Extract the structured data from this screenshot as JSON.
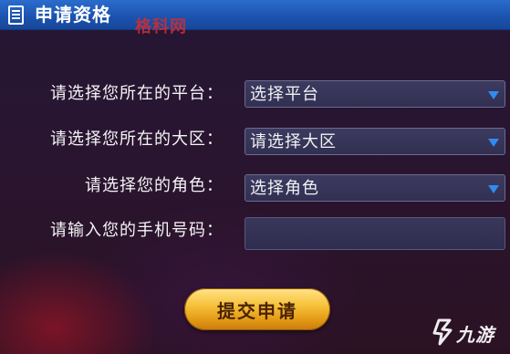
{
  "header": {
    "title": "申请资格",
    "icon": "document-icon"
  },
  "watermark": "格科网",
  "form": {
    "platform": {
      "label": "请选择您所在的平台：",
      "value": "选择平台"
    },
    "region": {
      "label": "请选择您所在的大区：",
      "value": "请选择大区"
    },
    "role": {
      "label": "请选择您的角色：",
      "value": "选择角色"
    },
    "phone": {
      "label": "请输入您的手机号码：",
      "value": ""
    },
    "submit_label": "提交申请"
  },
  "brand": {
    "text": "九游",
    "icon": "9game-logo-icon"
  },
  "colors": {
    "header_blue": "#1c52ad",
    "caret_blue": "#2f8cf0",
    "button_gold": "#f7c23c",
    "watermark_red": "#d62c2c"
  }
}
